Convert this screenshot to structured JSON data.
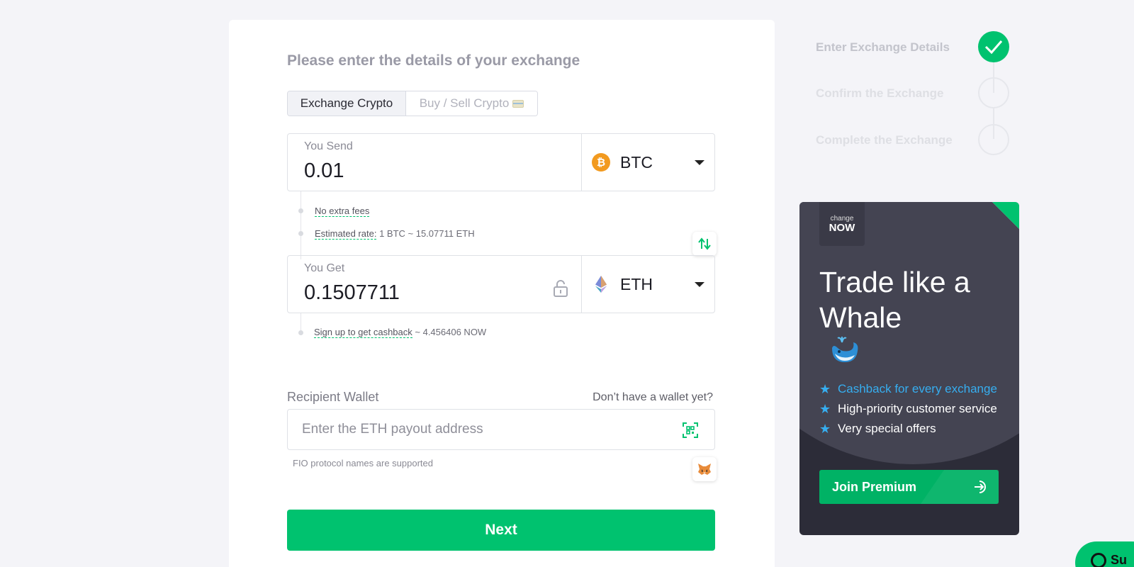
{
  "form": {
    "heading": "Please enter the details of your exchange",
    "tabs": [
      {
        "label": "Exchange Crypto",
        "active": true
      },
      {
        "label": "Buy / Sell Crypto",
        "active": false
      }
    ],
    "send": {
      "label": "You Send",
      "amount": "0.01",
      "currency": "BTC"
    },
    "fees_text": "No extra fees",
    "rate_label": "Estimated rate:",
    "rate_value": "1 BTC ~ 15.07711 ETH",
    "get": {
      "label": "You Get",
      "amount": "0.1507711",
      "currency": "ETH"
    },
    "cashback_link": "Sign up to get cashback",
    "cashback_value": "~ 4.456406 NOW",
    "wallet": {
      "label": "Recipient Wallet",
      "hint": "Don’t have a wallet yet?",
      "placeholder": "Enter the ETH payout address",
      "note": "FIO protocol names are supported"
    },
    "next_label": "Next"
  },
  "steps": [
    {
      "label": "Enter Exchange Details",
      "done": true
    },
    {
      "label": "Confirm the Exchange",
      "done": false
    },
    {
      "label": "Complete the Exchange",
      "done": false
    }
  ],
  "promo": {
    "logo_small": "change",
    "logo_big": "NOW",
    "title": "Trade like a Whale",
    "bullets": [
      "Cashback for every exchange",
      "High-priority customer service",
      "Very special offers"
    ],
    "button_label": "Join Premium"
  },
  "support": {
    "label": "Su"
  },
  "colors": {
    "accent": "#00c26f",
    "promo_bg": "#2c2c38",
    "highlight": "#36aef0",
    "btc": "#f29a1f"
  }
}
